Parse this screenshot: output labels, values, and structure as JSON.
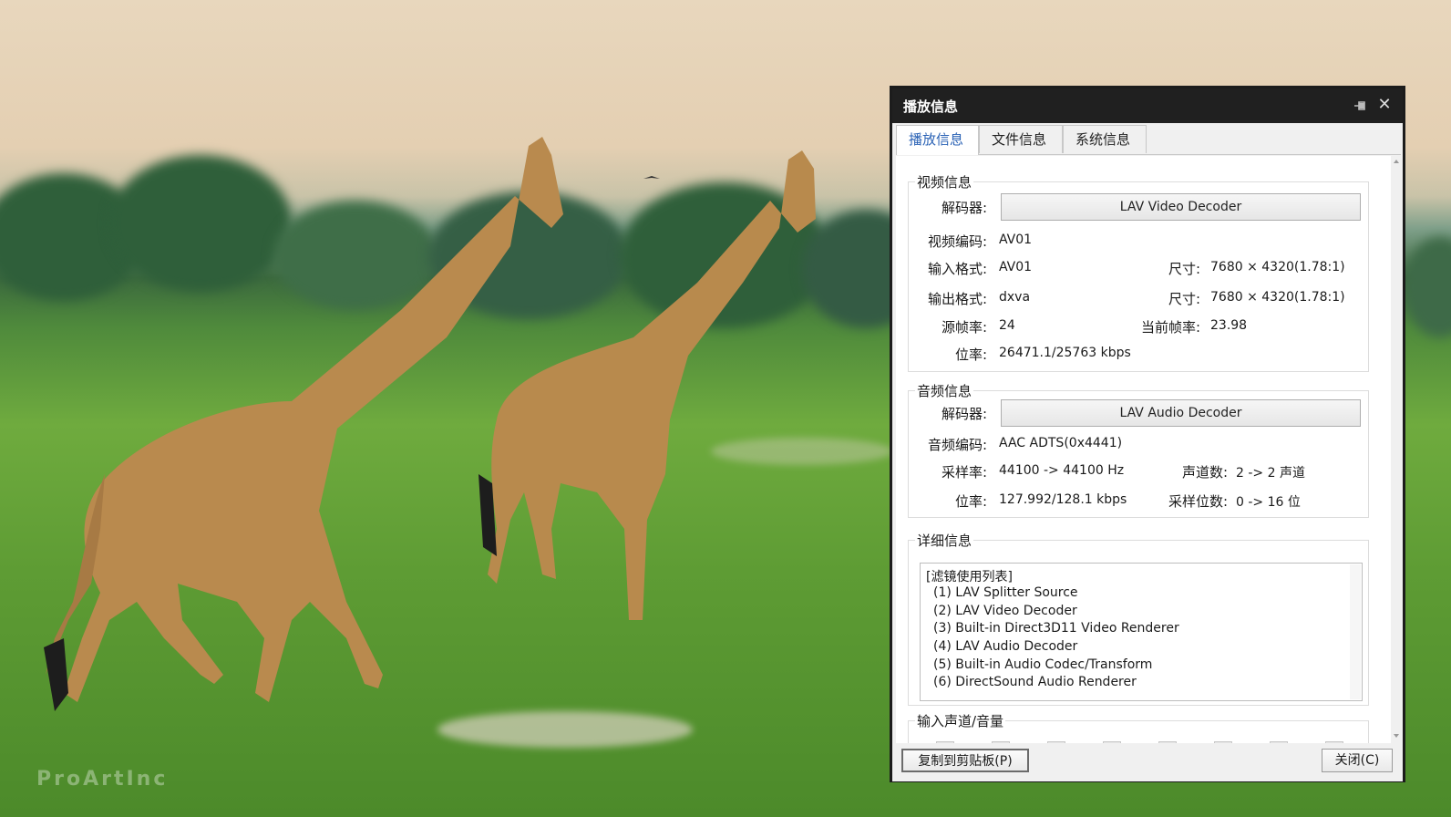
{
  "watermark": "ProArtInc",
  "dialog": {
    "title": "播放信息",
    "tabs": [
      "播放信息",
      "文件信息",
      "系统信息"
    ],
    "video": {
      "legend": "视频信息",
      "decoder_label": "解码器:",
      "decoder": "LAV Video Decoder",
      "codec_label": "视频编码:",
      "codec": "AV01",
      "input_label": "输入格式:",
      "input": "AV01",
      "input_size_label": "尺寸:",
      "input_size": "7680 × 4320(1.78:1)",
      "output_label": "输出格式:",
      "output": "dxva",
      "output_size_label": "尺寸:",
      "output_size": "7680 × 4320(1.78:1)",
      "src_fps_label": "源帧率:",
      "src_fps": "24",
      "cur_fps_label": "当前帧率:",
      "cur_fps": "23.98",
      "bitrate_label": "位率:",
      "bitrate": "26471.1/25763 kbps"
    },
    "audio": {
      "legend": "音频信息",
      "decoder_label": "解码器:",
      "decoder": "LAV Audio Decoder",
      "codec_label": "音频编码:",
      "codec": "AAC ADTS(0x4441)",
      "samplerate_label": "采样率:",
      "samplerate": "44100 -> 44100 Hz",
      "channels_label": "声道数:",
      "channels": "2 -> 2 声道",
      "bitrate_label": "位率:",
      "bitrate": "127.992/128.1 kbps",
      "bits_label": "采样位数:",
      "bits": "0 -> 16 位"
    },
    "details": {
      "legend": "详细信息",
      "lines": [
        "[滤镜使用列表]",
        "(1) LAV Splitter Source",
        "(2) LAV Video Decoder",
        "(3) Built-in Direct3D11 Video Renderer",
        "(4) LAV Audio Decoder",
        "(5) Built-in Audio Codec/Transform",
        "(6) DirectSound Audio Renderer"
      ]
    },
    "volume": {
      "legend": "输入声道/音量"
    },
    "footer": {
      "copy": "复制到剪贴板(P)",
      "close": "关闭(C)"
    }
  }
}
